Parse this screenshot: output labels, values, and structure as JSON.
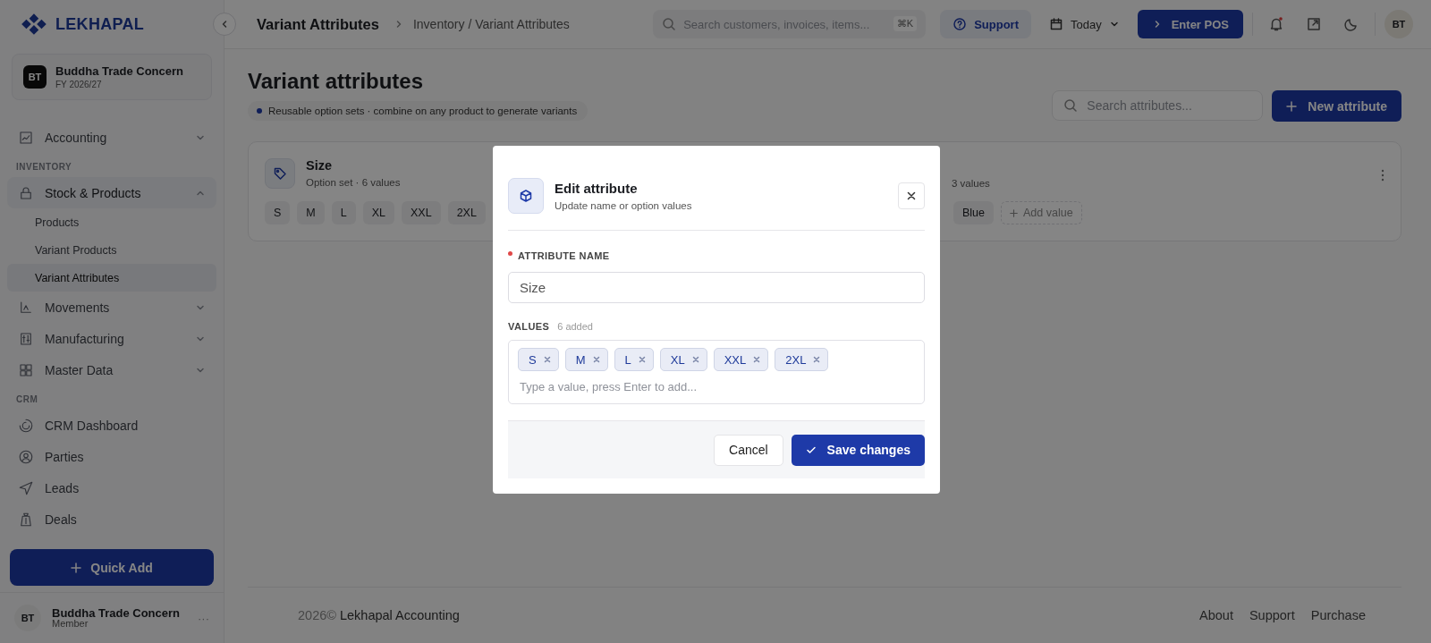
{
  "brand": {
    "name": "LEKHAPAL"
  },
  "header": {
    "title": "Variant Attributes",
    "breadcrumb": "Inventory / Variant Attributes",
    "search": {
      "placeholder": "Search customers, invoices, items..."
    },
    "shortcut": "⌘K",
    "support": "Support",
    "date": "Today",
    "pos": "Enter POS",
    "notifications_unread": true,
    "avatar": "BT"
  },
  "company": {
    "initials": "BT",
    "name": "Buddha Trade Concern",
    "fy": "FY 2026/27"
  },
  "sidebar": [
    {
      "kind": "group",
      "label": "Accounting",
      "expanded": false,
      "selected": false
    },
    {
      "kind": "heading",
      "label": "INVENTORY"
    },
    {
      "kind": "group",
      "label": "Stock & Products",
      "expanded": true,
      "selected": true,
      "children": [
        {
          "label": "Products",
          "selected": false
        },
        {
          "label": "Variant Products",
          "selected": false
        },
        {
          "label": "Variant Attributes",
          "selected": true
        }
      ]
    },
    {
      "kind": "group",
      "label": "Movements",
      "expanded": false,
      "selected": false
    },
    {
      "kind": "group",
      "label": "Manufacturing",
      "expanded": false,
      "selected": false
    },
    {
      "kind": "group",
      "label": "Master Data",
      "expanded": false,
      "selected": false
    },
    {
      "kind": "heading",
      "label": "CRM"
    },
    {
      "kind": "link",
      "label": "CRM Dashboard",
      "selected": false
    },
    {
      "kind": "link",
      "label": "Parties",
      "selected": false
    },
    {
      "kind": "link",
      "label": "Leads",
      "selected": false
    },
    {
      "kind": "link",
      "label": "Deals",
      "selected": false
    }
  ],
  "quick_add": "Quick Add",
  "user": {
    "initials": "BT",
    "name": "Buddha Trade Concern",
    "role": "Member",
    "more": "···"
  },
  "page": {
    "title": "Variant attributes",
    "tagline": "Reusable option sets · combine on any product to generate variants",
    "search": {
      "placeholder": "Search attributes..."
    },
    "new_button": "New attribute"
  },
  "attributes": [
    {
      "title": "Size",
      "meta": "Option set · 6 values",
      "values": [
        "S",
        "M",
        "L",
        "XL",
        "XXL",
        "2XL"
      ]
    },
    {
      "meta": "3 values",
      "values": [
        "Blue"
      ],
      "add": "Add value"
    }
  ],
  "footer": {
    "year": "2026©",
    "name": "Lekhapal Accounting",
    "links": [
      "About",
      "Support",
      "Purchase"
    ]
  },
  "modal": {
    "title": "Edit attribute",
    "subtitle": "Update name or option values",
    "name_label": "ATTRIBUTE NAME",
    "required": true,
    "name_value": "Size",
    "values_label": "VALUES",
    "values_count": "6 added",
    "tags": [
      "S",
      "M",
      "L",
      "XL",
      "XXL",
      "2XL"
    ],
    "values_placeholder": "Type a value, press Enter to add...",
    "cancel": "Cancel",
    "save": "Save changes"
  }
}
